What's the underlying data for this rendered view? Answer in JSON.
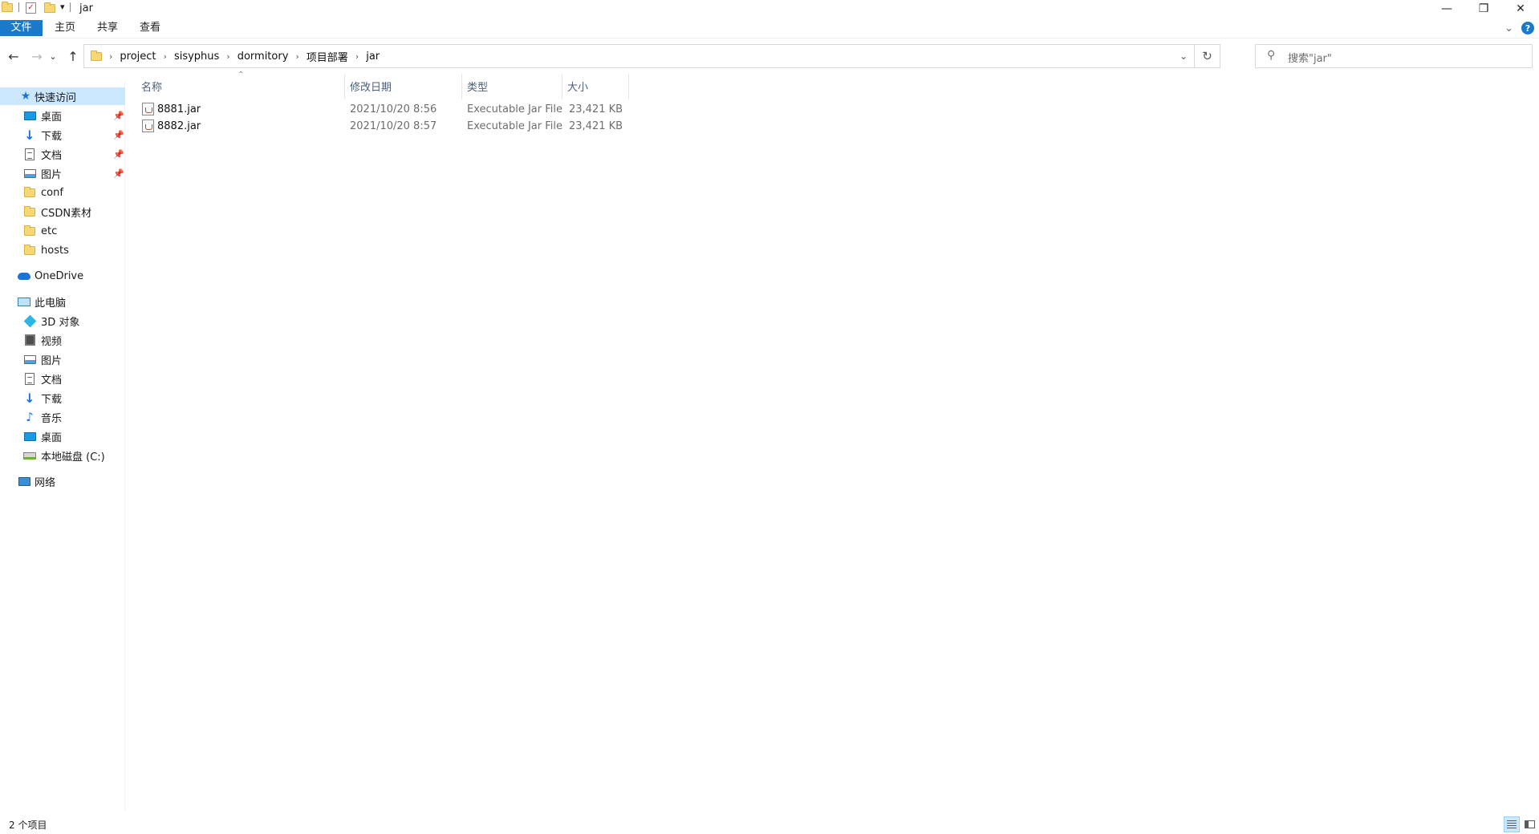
{
  "window": {
    "title": "jar",
    "minimize_glyph": "—",
    "restore_glyph": "❐",
    "close_glyph": "✕"
  },
  "ribbon": {
    "tabs": [
      "文件",
      "主页",
      "共享",
      "查看"
    ],
    "help_glyph": "?",
    "expand_glyph": "⌄"
  },
  "navigation": {
    "back_glyph": "←",
    "forward_glyph": "→",
    "recent_glyph": "⌄",
    "up_glyph": "↑",
    "breadcrumbs": [
      "project",
      "sisyphus",
      "dormitory",
      "项目部署",
      "jar"
    ],
    "separator": "›",
    "dropdown_glyph": "⌄",
    "refresh_glyph": "↻"
  },
  "search": {
    "placeholder": "搜索\"jar\"",
    "icon": "search-icon"
  },
  "sidebar": {
    "quick_access": {
      "label": "快速访问",
      "items": [
        {
          "label": "桌面",
          "icon": "desktop-icon",
          "pinned": true
        },
        {
          "label": "下载",
          "icon": "download-icon",
          "pinned": true
        },
        {
          "label": "文档",
          "icon": "documents-icon",
          "pinned": true
        },
        {
          "label": "图片",
          "icon": "pictures-icon",
          "pinned": true
        },
        {
          "label": "conf",
          "icon": "folder-icon",
          "pinned": false
        },
        {
          "label": "CSDN素材",
          "icon": "folder-icon",
          "pinned": false
        },
        {
          "label": "etc",
          "icon": "folder-icon",
          "pinned": false
        },
        {
          "label": "hosts",
          "icon": "folder-icon",
          "pinned": false
        }
      ]
    },
    "onedrive": {
      "label": "OneDrive"
    },
    "this_pc": {
      "label": "此电脑",
      "items": [
        {
          "label": "3D 对象",
          "icon": "3d-objects-icon"
        },
        {
          "label": "视频",
          "icon": "videos-icon"
        },
        {
          "label": "图片",
          "icon": "pictures-icon"
        },
        {
          "label": "文档",
          "icon": "documents-icon"
        },
        {
          "label": "下载",
          "icon": "download-icon"
        },
        {
          "label": "音乐",
          "icon": "music-icon"
        },
        {
          "label": "桌面",
          "icon": "desktop-icon"
        },
        {
          "label": "本地磁盘 (C:)",
          "icon": "local-disk-icon"
        }
      ]
    },
    "network": {
      "label": "网络"
    },
    "pin_glyph": "📌"
  },
  "file_list": {
    "columns": [
      "名称",
      "修改日期",
      "类型",
      "大小"
    ],
    "sort_glyph": "⌃",
    "rows": [
      {
        "name": "8881.jar",
        "modified": "2021/10/20 8:56",
        "type": "Executable Jar File",
        "size": "23,421 KB"
      },
      {
        "name": "8882.jar",
        "modified": "2021/10/20 8:57",
        "type": "Executable Jar File",
        "size": "23,421 KB"
      }
    ]
  },
  "status": {
    "item_count": "2 个项目"
  },
  "colors": {
    "accent": "#1979ca",
    "selection": "#cce8ff",
    "header_text": "#4c607a"
  }
}
